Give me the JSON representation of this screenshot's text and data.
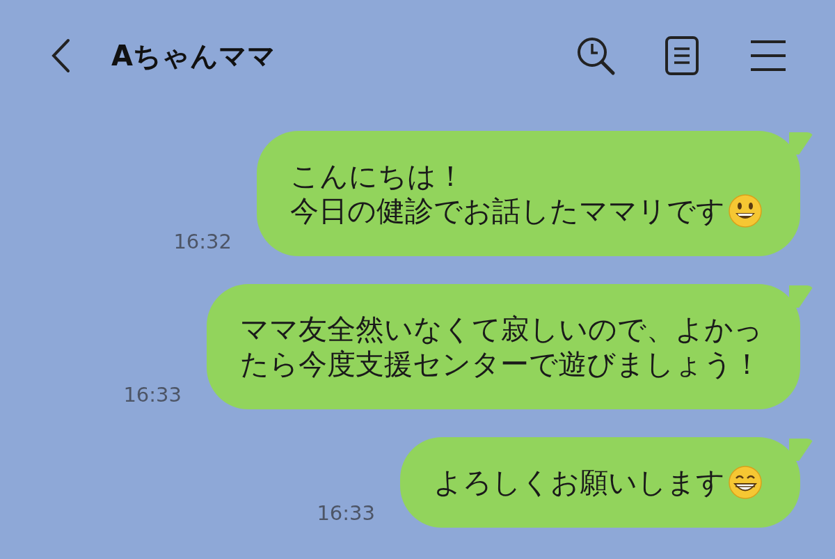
{
  "header": {
    "title": "Aちゃんママ"
  },
  "messages": [
    {
      "kind": "smile",
      "lines": [
        "こんにちは！",
        "今日の健診でお話したママリです"
      ],
      "time": "16:32"
    },
    {
      "kind": "plain",
      "lines": [
        "ママ友全然いなくて寂しいので、よかっ",
        "たら今度支援センターで遊びましょう！"
      ],
      "time": "16:33"
    },
    {
      "kind": "grin",
      "lines": [
        "よろしくお願いします"
      ],
      "time": "16:33"
    }
  ]
}
